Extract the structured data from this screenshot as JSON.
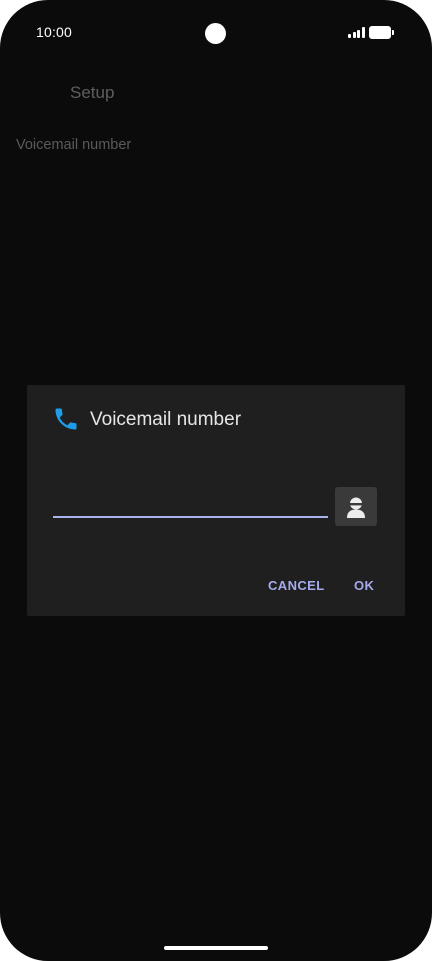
{
  "status_bar": {
    "time": "10:00",
    "signal_icon": "signal-bars-icon",
    "battery_icon": "battery-icon"
  },
  "screen": {
    "title": "Setup",
    "preference_label": "Voicemail number"
  },
  "dialog": {
    "icon": "phone-icon",
    "title": "Voicemail number",
    "number_input": {
      "value": "",
      "placeholder": ""
    },
    "contact_picker_icon": "contact-person-icon",
    "cancel_label": "CANCEL",
    "ok_label": "OK"
  },
  "colors": {
    "background": "#0b0b0b",
    "dialog_background": "#1f1f1f",
    "accent": "#a4acec",
    "phone_icon": "#1e9be9"
  }
}
